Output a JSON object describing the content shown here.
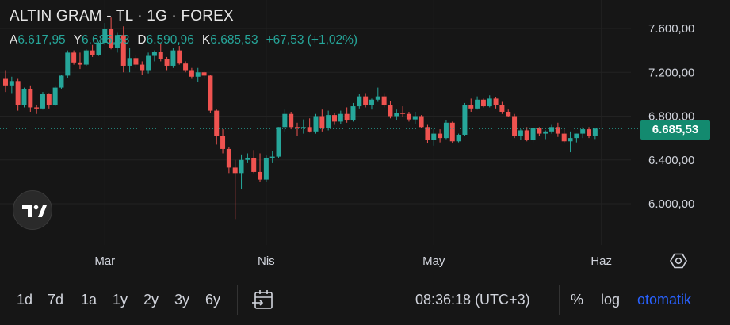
{
  "header": {
    "title": "ALTIN GRAM - TL · 1G · FOREX",
    "ohlc": [
      {
        "key": "A",
        "value": "6.617,95"
      },
      {
        "key": "Y",
        "value": "6.685,53"
      },
      {
        "key": "D",
        "value": "6.590,96"
      },
      {
        "key": "K",
        "value": "6.685,53"
      }
    ],
    "change": "+67,53 (+1,02%)"
  },
  "price_badge": "6.685,53",
  "range_buttons": [
    "1d",
    "7d",
    "1a",
    "1y",
    "2y",
    "3y",
    "6y"
  ],
  "time_label": "08:36:18 (UTC+3)",
  "options": {
    "percent": "%",
    "log": "log",
    "auto": "otomatik"
  },
  "colors": {
    "up": "#26a69a",
    "down": "#ef5350",
    "background": "#161616",
    "accent": "#2962ff",
    "badge": "#138a6f"
  },
  "icons": [
    "tradingview-logo-icon",
    "settings-icon",
    "calendar-goto-icon"
  ],
  "chart_data": {
    "type": "candlestick",
    "y_ticks": [
      {
        "value": 7600,
        "label": "7.600,00"
      },
      {
        "value": 7200,
        "label": "7.200,00"
      },
      {
        "value": 6800,
        "label": "6.800,00"
      },
      {
        "value": 6400,
        "label": "6.400,00"
      },
      {
        "value": 6000,
        "label": "6.000,00"
      }
    ],
    "x_ticks": [
      {
        "index": 16,
        "label": "Mar"
      },
      {
        "index": 42,
        "label": "Nis"
      },
      {
        "index": 69,
        "label": "May"
      },
      {
        "index": 96,
        "label": "Haz"
      }
    ],
    "last_price": 6685.53,
    "candles": [
      [
        7140,
        7220,
        7020,
        7080
      ],
      [
        7080,
        7160,
        7010,
        7120
      ],
      [
        7120,
        7140,
        6850,
        6900
      ],
      [
        6900,
        7060,
        6880,
        7050
      ],
      [
        7050,
        7080,
        6840,
        6880
      ],
      [
        6880,
        6900,
        6820,
        6870
      ],
      [
        6870,
        7020,
        6860,
        7000
      ],
      [
        7000,
        7010,
        6870,
        6900
      ],
      [
        6900,
        7080,
        6890,
        7060
      ],
      [
        7060,
        7180,
        7050,
        7170
      ],
      [
        7170,
        7400,
        7150,
        7380
      ],
      [
        7380,
        7400,
        7270,
        7290
      ],
      [
        7290,
        7380,
        7230,
        7270
      ],
      [
        7270,
        7410,
        7260,
        7400
      ],
      [
        7400,
        7450,
        7340,
        7360
      ],
      [
        7360,
        7480,
        7350,
        7470
      ],
      [
        7470,
        7650,
        7450,
        7600
      ],
      [
        7600,
        7700,
        7410,
        7420
      ],
      [
        7420,
        7560,
        7380,
        7540
      ],
      [
        7540,
        7620,
        7200,
        7260
      ],
      [
        7260,
        7420,
        7200,
        7330
      ],
      [
        7330,
        7360,
        7240,
        7270
      ],
      [
        7270,
        7300,
        7180,
        7220
      ],
      [
        7220,
        7380,
        7190,
        7350
      ],
      [
        7350,
        7400,
        7300,
        7390
      ],
      [
        7390,
        7460,
        7300,
        7320
      ],
      [
        7320,
        7340,
        7220,
        7260
      ],
      [
        7260,
        7420,
        7240,
        7400
      ],
      [
        7400,
        7440,
        7270,
        7280
      ],
      [
        7280,
        7300,
        7200,
        7220
      ],
      [
        7220,
        7240,
        7140,
        7160
      ],
      [
        7160,
        7240,
        7110,
        7200
      ],
      [
        7200,
        7210,
        7140,
        7170
      ],
      [
        7170,
        7180,
        6830,
        6850
      ],
      [
        6850,
        6860,
        6540,
        6620
      ],
      [
        6620,
        6680,
        6460,
        6500
      ],
      [
        6500,
        6520,
        6280,
        6330
      ],
      [
        6330,
        6400,
        5860,
        6280
      ],
      [
        6280,
        6450,
        6130,
        6400
      ],
      [
        6400,
        6460,
        6370,
        6420
      ],
      [
        6420,
        6490,
        6280,
        6290
      ],
      [
        6290,
        6460,
        6200,
        6220
      ],
      [
        6220,
        6440,
        6200,
        6420
      ],
      [
        6420,
        6480,
        6370,
        6430
      ],
      [
        6430,
        6700,
        6420,
        6700
      ],
      [
        6700,
        6860,
        6660,
        6820
      ],
      [
        6820,
        6840,
        6680,
        6700
      ],
      [
        6700,
        6740,
        6620,
        6690
      ],
      [
        6690,
        6770,
        6640,
        6700
      ],
      [
        6700,
        6780,
        6650,
        6660
      ],
      [
        6660,
        6820,
        6640,
        6800
      ],
      [
        6800,
        6860,
        6660,
        6690
      ],
      [
        6690,
        6850,
        6670,
        6810
      ],
      [
        6810,
        6830,
        6720,
        6750
      ],
      [
        6750,
        6850,
        6730,
        6820
      ],
      [
        6820,
        6880,
        6740,
        6760
      ],
      [
        6760,
        6920,
        6750,
        6890
      ],
      [
        6890,
        7000,
        6870,
        6980
      ],
      [
        6980,
        7010,
        6880,
        6900
      ],
      [
        6900,
        6960,
        6860,
        6950
      ],
      [
        6950,
        7060,
        6930,
        6980
      ],
      [
        6980,
        7010,
        6880,
        6900
      ],
      [
        6900,
        6940,
        6780,
        6800
      ],
      [
        6800,
        6860,
        6760,
        6830
      ],
      [
        6830,
        6890,
        6790,
        6820
      ],
      [
        6820,
        6840,
        6750,
        6770
      ],
      [
        6770,
        6840,
        6730,
        6800
      ],
      [
        6800,
        6810,
        6690,
        6700
      ],
      [
        6700,
        6720,
        6550,
        6580
      ],
      [
        6580,
        6680,
        6530,
        6640
      ],
      [
        6640,
        6680,
        6560,
        6600
      ],
      [
        6600,
        6760,
        6590,
        6740
      ],
      [
        6740,
        6750,
        6550,
        6570
      ],
      [
        6570,
        6640,
        6560,
        6630
      ],
      [
        6630,
        6920,
        6620,
        6900
      ],
      [
        6900,
        6960,
        6840,
        6870
      ],
      [
        6870,
        6980,
        6860,
        6950
      ],
      [
        6950,
        6960,
        6880,
        6890
      ],
      [
        6890,
        6990,
        6880,
        6960
      ],
      [
        6960,
        6970,
        6870,
        6900
      ],
      [
        6900,
        6930,
        6820,
        6840
      ],
      [
        6840,
        6860,
        6790,
        6800
      ],
      [
        6800,
        6820,
        6600,
        6620
      ],
      [
        6620,
        6680,
        6580,
        6670
      ],
      [
        6670,
        6700,
        6570,
        6580
      ],
      [
        6580,
        6700,
        6560,
        6690
      ],
      [
        6690,
        6700,
        6620,
        6640
      ],
      [
        6640,
        6670,
        6590,
        6660
      ],
      [
        6660,
        6720,
        6640,
        6700
      ],
      [
        6700,
        6740,
        6610,
        6640
      ],
      [
        6640,
        6680,
        6560,
        6570
      ],
      [
        6570,
        6660,
        6470,
        6600
      ],
      [
        6600,
        6640,
        6560,
        6640
      ],
      [
        6640,
        6700,
        6600,
        6680
      ],
      [
        6680,
        6700,
        6600,
        6618
      ],
      [
        6618,
        6686,
        6591,
        6686
      ]
    ]
  }
}
